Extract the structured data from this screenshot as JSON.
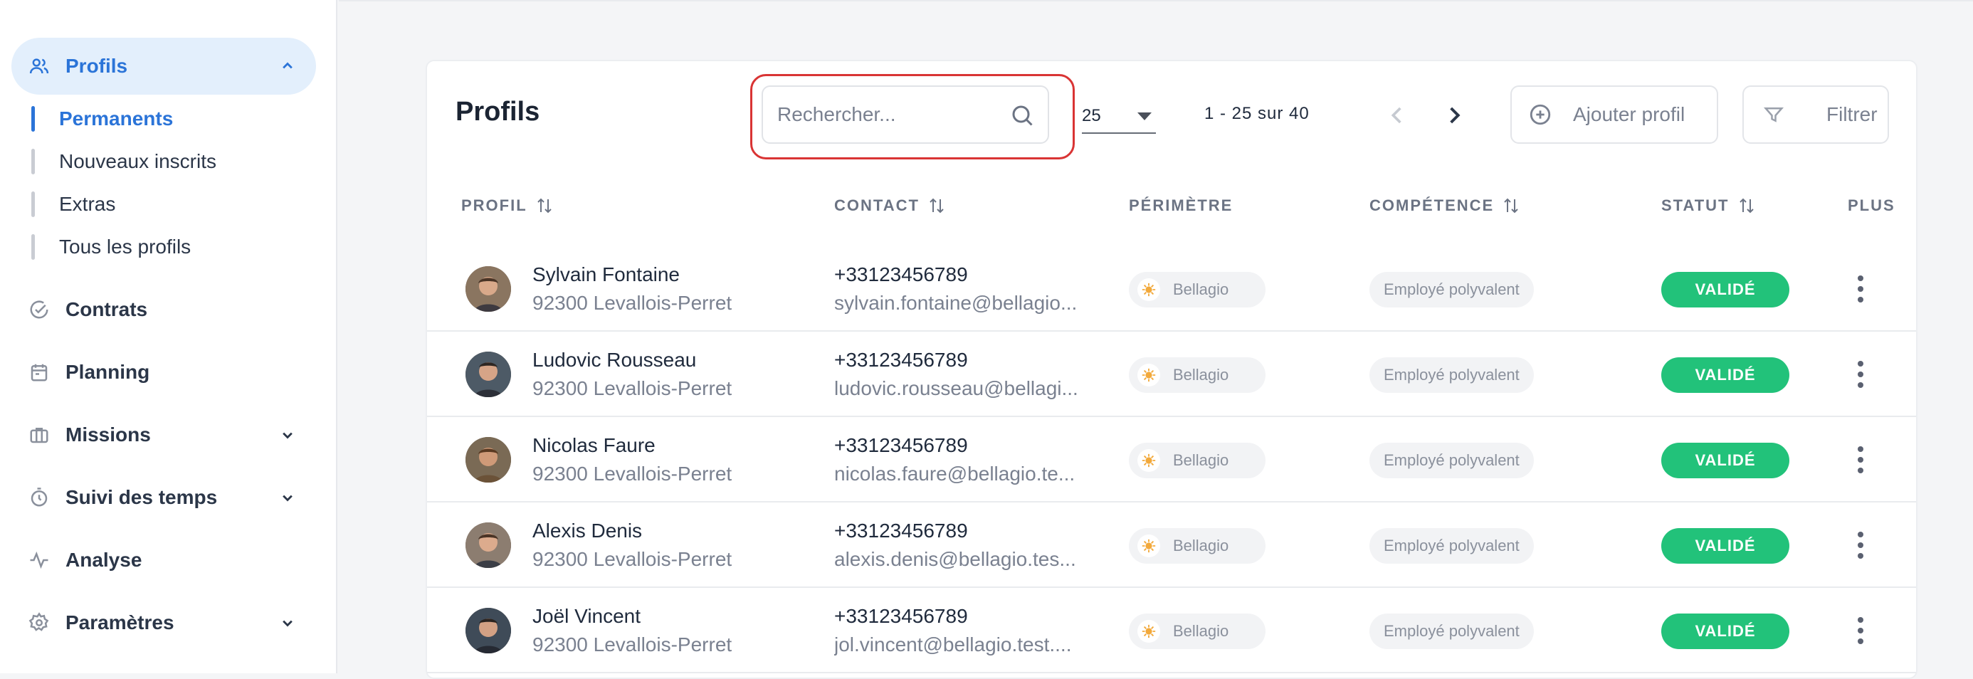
{
  "sidebar": {
    "profils": "Profils",
    "sub_items": [
      "Permanents",
      "Nouveaux inscrits",
      "Extras",
      "Tous les profils"
    ],
    "contrats": "Contrats",
    "planning": "Planning",
    "missions": "Missions",
    "suivi": "Suivi des temps",
    "analyse": "Analyse",
    "parametres": "Paramètres"
  },
  "header": {
    "title": "Profils",
    "search_placeholder": "Rechercher...",
    "per_page": "25",
    "range": "1 - 25 sur 40",
    "add_label": "Ajouter profil",
    "filter_label": "Filtrer"
  },
  "columns": {
    "profil": "PROFIL",
    "contact": "CONTACT",
    "perimetre": "PÉRIMÈTRE",
    "competence": "COMPÉTENCE",
    "statut": "STATUT",
    "plus": "PLUS"
  },
  "rows": [
    {
      "name": "Sylvain Fontaine",
      "address": "92300 Levallois-Perret",
      "phone": "+33123456789",
      "email": "sylvain.fontaine@bellagio...",
      "perimeter": "Bellagio",
      "competence": "Employé polyvalent",
      "status": "VALIDÉ"
    },
    {
      "name": "Ludovic Rousseau",
      "address": "92300 Levallois-Perret",
      "phone": "+33123456789",
      "email": "ludovic.rousseau@bellagi...",
      "perimeter": "Bellagio",
      "competence": "Employé polyvalent",
      "status": "VALIDÉ"
    },
    {
      "name": "Nicolas Faure",
      "address": "92300 Levallois-Perret",
      "phone": "+33123456789",
      "email": "nicolas.faure@bellagio.te...",
      "perimeter": "Bellagio",
      "competence": "Employé polyvalent",
      "status": "VALIDÉ"
    },
    {
      "name": "Alexis Denis",
      "address": "92300 Levallois-Perret",
      "phone": "+33123456789",
      "email": "alexis.denis@bellagio.tes...",
      "perimeter": "Bellagio",
      "competence": "Employé polyvalent",
      "status": "VALIDÉ"
    },
    {
      "name": "Joël Vincent",
      "address": "92300 Levallois-Perret",
      "phone": "+33123456789",
      "email": "jol.vincent@bellagio.test....",
      "perimeter": "Bellagio",
      "competence": "Employé polyvalent",
      "status": "VALIDÉ"
    }
  ],
  "colors": {
    "accent": "#2b74d8",
    "status_green": "#22c27a",
    "highlight_red": "#d93434"
  }
}
